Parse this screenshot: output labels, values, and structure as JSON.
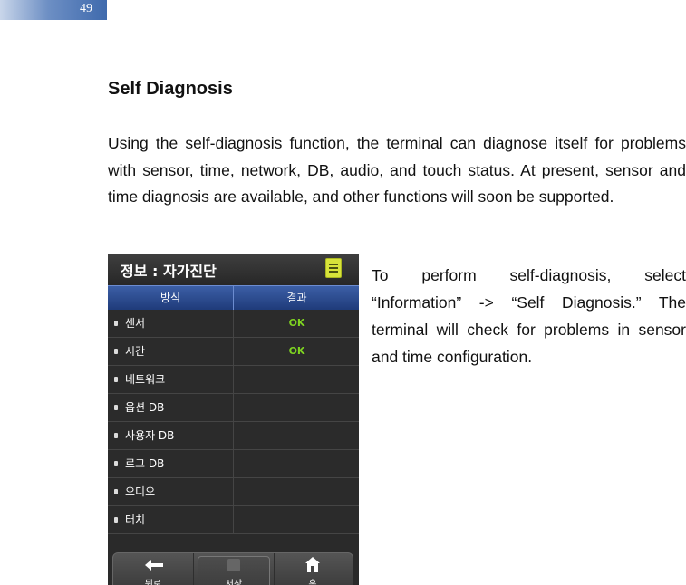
{
  "page_number": "49",
  "heading": "Self Diagnosis",
  "intro": "Using the self-diagnosis function, the terminal can diagnose itself for problems with sensor, time, network, DB, audio, and touch status. At present, sensor and time diagnosis are available, and other functions will soon be supported.",
  "side_text": "To perform self-diagnosis, select “Information” -> “Self Diagnosis.” The terminal will check for problems in sensor and time configuration.",
  "device": {
    "title": "정보 : 자가진단",
    "col_method": "방식",
    "col_result": "결과",
    "rows": [
      {
        "label": "센서",
        "result": "OK"
      },
      {
        "label": "시간",
        "result": "OK"
      },
      {
        "label": "네트워크",
        "result": ""
      },
      {
        "label": "옵션 DB",
        "result": ""
      },
      {
        "label": "사용자 DB",
        "result": ""
      },
      {
        "label": "로그 DB",
        "result": ""
      },
      {
        "label": "오디오",
        "result": ""
      },
      {
        "label": "터치",
        "result": ""
      }
    ],
    "toolbar": {
      "back": "뒤로",
      "save": "저장",
      "home": "홈"
    },
    "colors": {
      "ok": "#7ed321",
      "header": "#2b4b8f"
    }
  }
}
